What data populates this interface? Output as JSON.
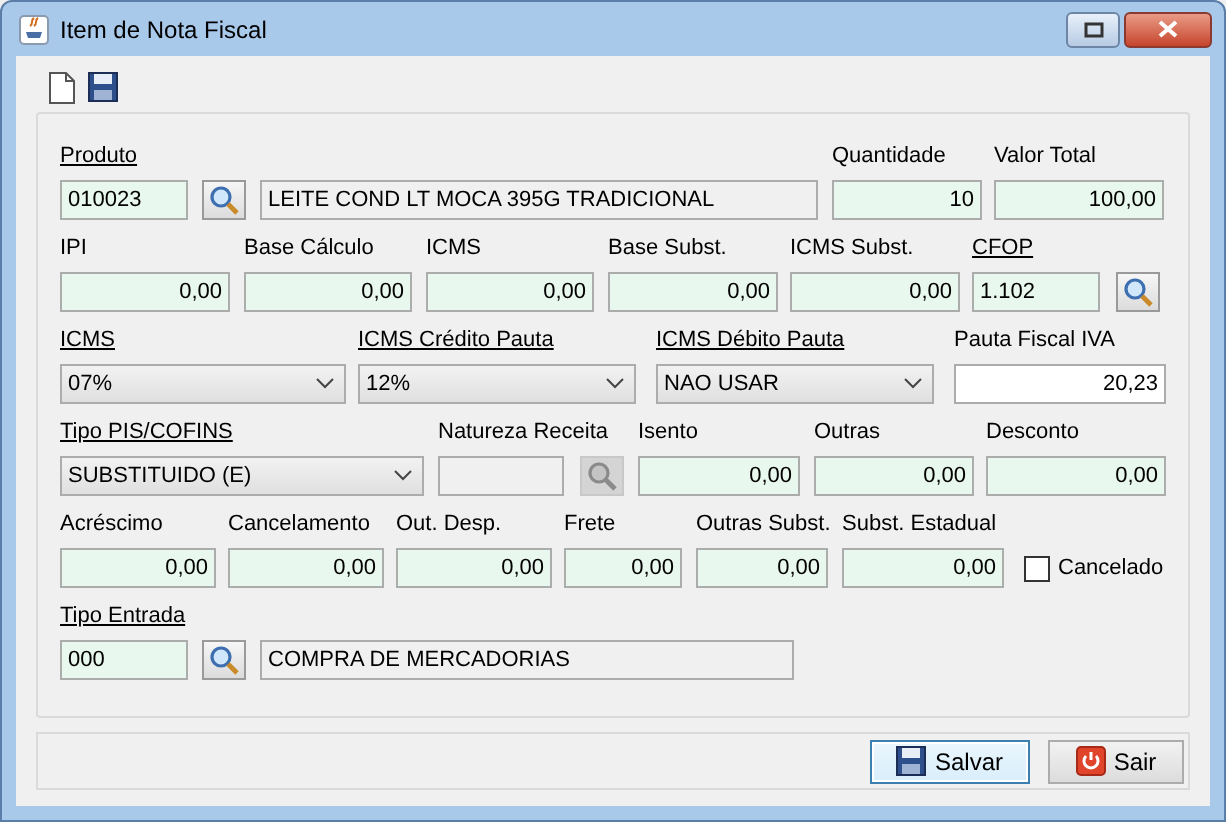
{
  "window": {
    "title": "Item de Nota Fiscal"
  },
  "form_rows": [
    {
      "fields": [
        {
          "kind": "input",
          "label": "Produto",
          "link": true,
          "value": "010023",
          "highlighted": true
        },
        {
          "kind": "lookup",
          "disabled": false
        },
        {
          "kind": "display",
          "value": "LEITE COND LT MOCA 395G TRADICIONAL"
        },
        {
          "kind": "input",
          "label": "Quantidade",
          "link": false,
          "value": "10",
          "highlighted": true
        },
        {
          "kind": "input",
          "label": "Valor Total",
          "link": false,
          "value": "100,00",
          "highlighted": true
        }
      ]
    },
    {
      "fields": [
        {
          "kind": "input",
          "label": "IPI",
          "link": false,
          "value": "0,00",
          "highlighted": true
        },
        {
          "kind": "input",
          "label": "Base Cálculo",
          "link": false,
          "value": "0,00",
          "highlighted": true
        },
        {
          "kind": "input",
          "label": "ICMS",
          "link": false,
          "value": "0,00",
          "highlighted": true
        },
        {
          "kind": "input",
          "label": "Base Subst.",
          "link": false,
          "value": "0,00",
          "highlighted": true
        },
        {
          "kind": "input",
          "label": "ICMS Subst.",
          "link": false,
          "value": "0,00",
          "highlighted": true
        },
        {
          "kind": "input",
          "label": "CFOP",
          "link": true,
          "value": "1.102",
          "highlighted": true
        },
        {
          "kind": "lookup",
          "disabled": false
        }
      ]
    },
    {
      "fields": [
        {
          "kind": "select",
          "label": "ICMS",
          "link": true,
          "value": "07%"
        },
        {
          "kind": "select",
          "label": "ICMS Crédito Pauta",
          "link": true,
          "value": "12%"
        },
        {
          "kind": "select",
          "label": "ICMS Débito Pauta",
          "link": true,
          "value": "NAO USAR"
        },
        {
          "kind": "input",
          "label": "Pauta Fiscal IVA",
          "link": false,
          "value": "20,23",
          "highlighted": false
        }
      ]
    },
    {
      "fields": [
        {
          "kind": "select",
          "label": "Tipo PIS/COFINS",
          "link": true,
          "value": "SUBSTITUIDO (E)"
        },
        {
          "kind": "display",
          "label": "Natureza Receita",
          "link": false
        },
        {
          "kind": "lookup",
          "disabled": true
        },
        {
          "kind": "input",
          "label": "Isento",
          "link": false,
          "value": "0,00",
          "highlighted": true
        },
        {
          "kind": "input",
          "label": "Outras",
          "link": false,
          "value": "0,00",
          "highlighted": true
        },
        {
          "kind": "input",
          "label": "Desconto",
          "link": false,
          "value": "0,00",
          "highlighted": true
        }
      ]
    },
    {
      "fields": [
        {
          "kind": "input",
          "label": "Acréscimo",
          "link": false,
          "value": "0,00",
          "highlighted": true
        },
        {
          "kind": "input",
          "label": "Cancelamento",
          "link": false,
          "value": "0,00",
          "highlighted": true
        },
        {
          "kind": "input",
          "label": "Out. Desp.",
          "link": false,
          "value": "0,00",
          "highlighted": true
        },
        {
          "kind": "input",
          "label": "Frete",
          "link": false,
          "value": "0,00",
          "highlighted": true
        },
        {
          "kind": "input",
          "label": "Outras Subst.",
          "link": false,
          "value": "0,00",
          "highlighted": true
        },
        {
          "kind": "input",
          "label": "Subst. Estadual",
          "link": false,
          "value": "0,00",
          "highlighted": true
        },
        {
          "kind": "checkbox",
          "label": "Cancelado",
          "checked": false
        }
      ]
    },
    {
      "fields": [
        {
          "kind": "input",
          "label": "Tipo Entrada",
          "link": true,
          "value": "000",
          "highlighted": true
        },
        {
          "kind": "lookup",
          "disabled": false
        },
        {
          "kind": "display",
          "value": "COMPRA DE MERCADORIAS"
        }
      ]
    }
  ],
  "buttons": [
    {
      "label": "Salvar",
      "kind": "save",
      "focused": true
    },
    {
      "label": "Sair",
      "kind": "exit",
      "focused": false
    }
  ]
}
